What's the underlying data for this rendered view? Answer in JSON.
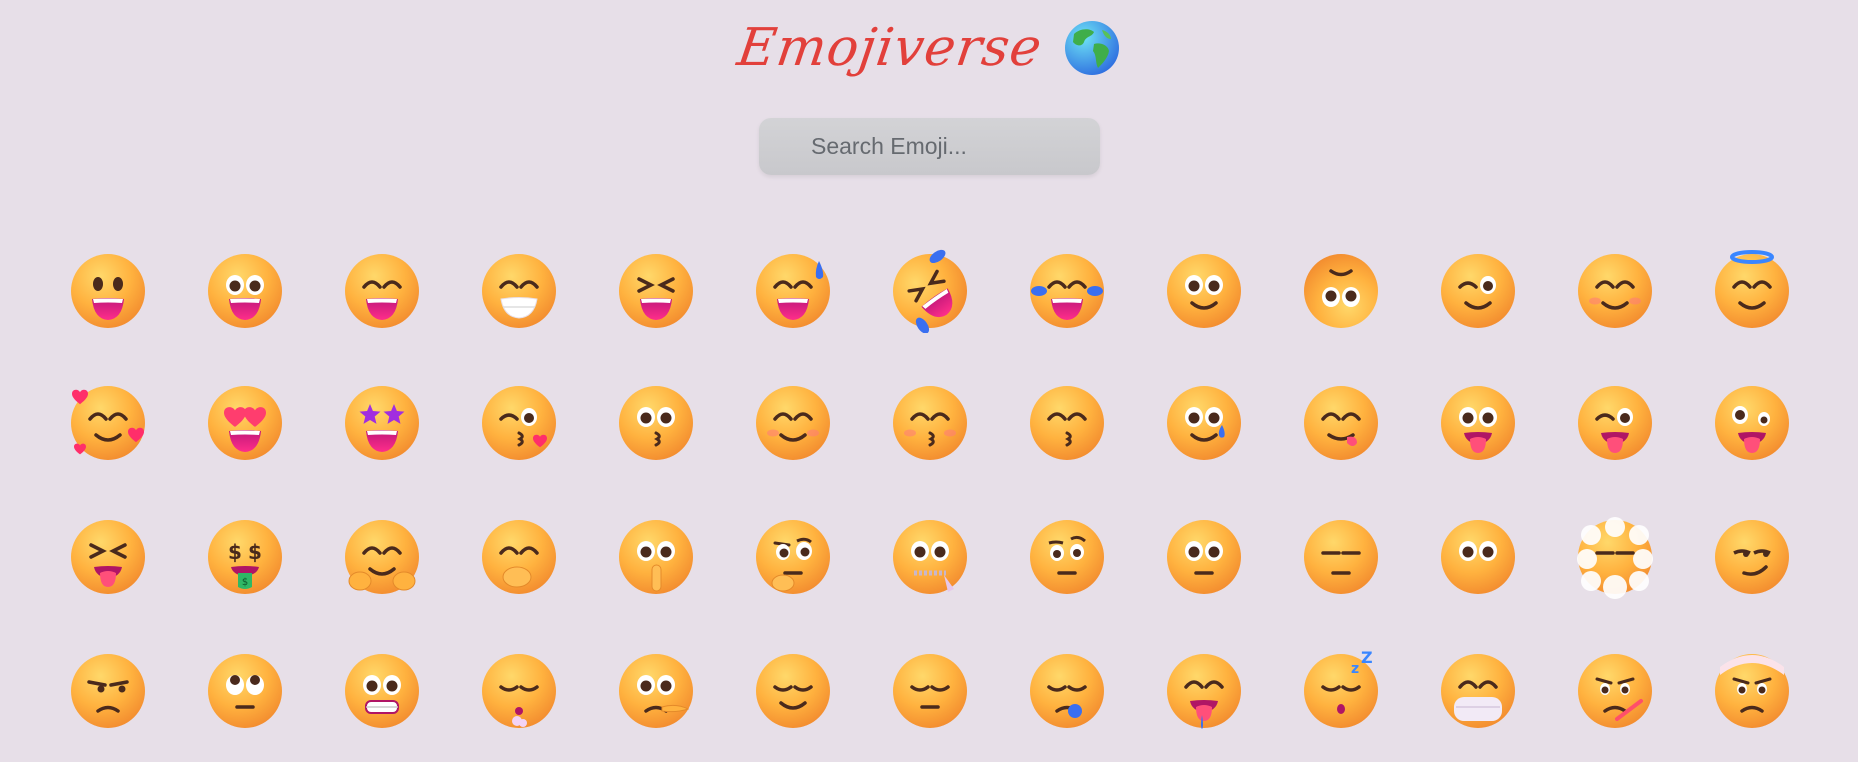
{
  "app": {
    "title": "Emojiverse",
    "logo_icon": "globe-icon"
  },
  "search": {
    "placeholder": "Search Emoji..."
  },
  "colors": {
    "title": "#e2403b",
    "background": "#e7dfe8",
    "face": "#ffb23f"
  },
  "emojis": [
    {
      "name": "grinning-face",
      "eyes": "dot",
      "mouth": "open"
    },
    {
      "name": "grinning-face-with-big-eyes",
      "eyes": "big",
      "mouth": "open"
    },
    {
      "name": "grinning-face-with-smiling-eyes",
      "eyes": "happy",
      "mouth": "open"
    },
    {
      "name": "beaming-face-with-smiling-eyes",
      "eyes": "happy",
      "mouth": "teeth"
    },
    {
      "name": "grinning-squinting-face",
      "eyes": "squint",
      "mouth": "open"
    },
    {
      "name": "grinning-face-with-sweat",
      "eyes": "happy",
      "mouth": "open",
      "extra": "sweat"
    },
    {
      "name": "rolling-on-the-floor-laughing",
      "eyes": "squint",
      "mouth": "open",
      "extra": "rofl"
    },
    {
      "name": "face-with-tears-of-joy",
      "eyes": "happy",
      "mouth": "open",
      "extra": "tears"
    },
    {
      "name": "slightly-smiling-face",
      "eyes": "big",
      "mouth": "smile"
    },
    {
      "name": "upside-down-face",
      "eyes": "big",
      "mouth": "frown",
      "extra": "upside"
    },
    {
      "name": "winking-face",
      "eyes": "wink",
      "mouth": "smile"
    },
    {
      "name": "smiling-face-with-smiling-eyes",
      "eyes": "happy",
      "mouth": "smile",
      "extra": "blush"
    },
    {
      "name": "smiling-face-with-halo",
      "eyes": "happy",
      "mouth": "smile",
      "extra": "halo"
    },
    {
      "name": "smiling-face-with-hearts",
      "eyes": "happy",
      "mouth": "smile",
      "extra": "hearts"
    },
    {
      "name": "smiling-face-with-heart-eyes",
      "eyes": "hearteyes",
      "mouth": "open"
    },
    {
      "name": "star-struck",
      "eyes": "stars",
      "mouth": "open"
    },
    {
      "name": "face-blowing-a-kiss",
      "eyes": "wink",
      "mouth": "kiss",
      "extra": "kissheart"
    },
    {
      "name": "kissing-face",
      "eyes": "big",
      "mouth": "kiss"
    },
    {
      "name": "smiling-face",
      "eyes": "happy",
      "mouth": "smile",
      "extra": "blush"
    },
    {
      "name": "kissing-face-with-closed-eyes",
      "eyes": "happy",
      "mouth": "kiss",
      "extra": "blush"
    },
    {
      "name": "kissing-face-with-smiling-eyes",
      "eyes": "happy",
      "mouth": "kiss"
    },
    {
      "name": "smiling-face-with-tear",
      "eyes": "big",
      "mouth": "smile",
      "extra": "tear"
    },
    {
      "name": "face-savoring-food",
      "eyes": "happy",
      "mouth": "tongue-side"
    },
    {
      "name": "face-with-tongue",
      "eyes": "big",
      "mouth": "tongue"
    },
    {
      "name": "winking-face-with-tongue",
      "eyes": "wink",
      "mouth": "tongue"
    },
    {
      "name": "zany-face",
      "eyes": "zany",
      "mouth": "tongue"
    },
    {
      "name": "squinting-face-with-tongue",
      "eyes": "squint",
      "mouth": "tongue"
    },
    {
      "name": "money-mouth-face",
      "eyes": "dollar",
      "mouth": "money"
    },
    {
      "name": "hugging-face",
      "eyes": "happy",
      "mouth": "smile",
      "extra": "hands"
    },
    {
      "name": "face-with-hand-over-mouth",
      "eyes": "happy",
      "mouth": "none",
      "extra": "handmouth"
    },
    {
      "name": "shushing-face",
      "eyes": "big",
      "mouth": "none",
      "extra": "finger"
    },
    {
      "name": "thinking-face",
      "eyes": "think",
      "mouth": "flat",
      "extra": "chin"
    },
    {
      "name": "zipper-mouth-face",
      "eyes": "big",
      "mouth": "zipper"
    },
    {
      "name": "face-with-raised-eyebrow",
      "eyes": "brow",
      "mouth": "flat"
    },
    {
      "name": "neutral-face",
      "eyes": "big",
      "mouth": "flat"
    },
    {
      "name": "expressionless-face",
      "eyes": "line",
      "mouth": "flat"
    },
    {
      "name": "face-without-mouth",
      "eyes": "big",
      "mouth": "none"
    },
    {
      "name": "face-in-clouds",
      "eyes": "line",
      "mouth": "none",
      "extra": "clouds"
    },
    {
      "name": "smirking-face",
      "eyes": "smirk",
      "mouth": "smirk"
    },
    {
      "name": "unamused-face",
      "eyes": "unamused",
      "mouth": "frown"
    },
    {
      "name": "face-with-rolling-eyes",
      "eyes": "rolling",
      "mouth": "flat"
    },
    {
      "name": "grimacing-face",
      "eyes": "big",
      "mouth": "grimace"
    },
    {
      "name": "face-exhaling",
      "eyes": "closed",
      "mouth": "puff"
    },
    {
      "name": "lying-face",
      "eyes": "big",
      "mouth": "frown",
      "extra": "nose"
    },
    {
      "name": "relieved-face",
      "eyes": "closed",
      "mouth": "smile"
    },
    {
      "name": "pensive-face",
      "eyes": "closed",
      "mouth": "flat"
    },
    {
      "name": "sleepy-face",
      "eyes": "closed",
      "mouth": "frown",
      "extra": "bubble"
    },
    {
      "name": "drooling-face",
      "eyes": "happy",
      "mouth": "tongue",
      "extra": "drool"
    },
    {
      "name": "sleeping-face",
      "eyes": "closed",
      "mouth": "sleep",
      "extra": "zzz"
    },
    {
      "name": "face-with-medical-mask",
      "eyes": "happy",
      "mouth": "none",
      "extra": "mask"
    },
    {
      "name": "face-with-thermometer",
      "eyes": "sad",
      "mouth": "frown",
      "extra": "thermo"
    },
    {
      "name": "face-with-head-bandage",
      "eyes": "sad",
      "mouth": "frown",
      "extra": "bandage"
    }
  ]
}
